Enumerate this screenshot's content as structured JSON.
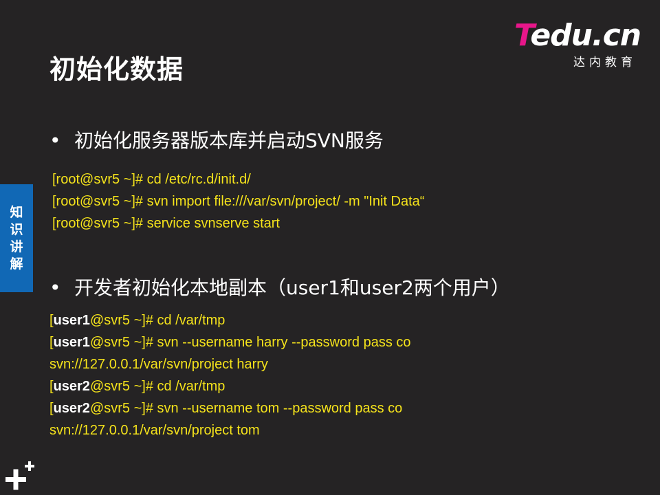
{
  "title": "初始化数据",
  "logo": {
    "t": "T",
    "rest": "edu.cn",
    "sub": "达内教育"
  },
  "side_tab": [
    "知",
    "识",
    "讲",
    "解"
  ],
  "bullets": [
    {
      "dot": "•",
      "text": "初始化服务器版本库并启动SVN服务"
    },
    {
      "dot": "•",
      "text": "开发者初始化本地副本（user1和user2两个用户）"
    }
  ],
  "code_block_1": [
    "[root@svr5 ~]# cd /etc/rc.d/init.d/",
    "[root@svr5 ~]# svn import file:///var/svn/project/  -m \"Init Data“",
    "[root@svr5 ~]# service svnserve start"
  ],
  "code_block_2": [
    {
      "pre": "[",
      "user": "user1",
      "post": "@svr5 ~]# cd /var/tmp"
    },
    {
      "pre": "[",
      "user": "user1",
      "post": "@svr5 ~]# svn --username harry --password pass co"
    },
    {
      "pre": "",
      "user": "",
      "post": "svn://127.0.0.1/var/svn/project harry"
    },
    {
      "pre": "[",
      "user": "user2",
      "post": "@svr5 ~]# cd /var/tmp"
    },
    {
      "pre": "[",
      "user": "user2",
      "post": "@svr5 ~]# svn --username tom --password pass co"
    },
    {
      "pre": "",
      "user": "",
      "post": "svn://127.0.0.1/var/svn/project tom"
    }
  ],
  "colors": {
    "background": "#252324",
    "code": "#f5e31b",
    "accent_blue": "#1168b5",
    "brand_pink": "#e8168a"
  },
  "icons": {
    "corner": "plus-icon"
  }
}
